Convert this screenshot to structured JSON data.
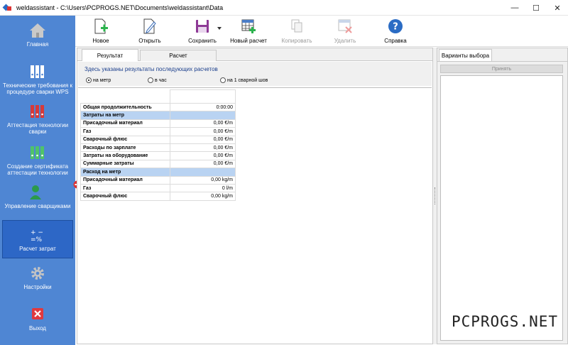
{
  "window": {
    "title": "weldassistant - C:\\Users\\PCPROGS.NET\\Documents\\weldassistant\\Data",
    "controls": {
      "minimize": "—",
      "maximize": "☐",
      "close": "✕"
    }
  },
  "sidebar": {
    "items": [
      {
        "label": "Главная",
        "icon": "home-icon"
      },
      {
        "label": "Технические требования к процедуре сварки WPS",
        "icon": "binders-icon"
      },
      {
        "label": "Аттестация технологии сварки",
        "icon": "binders-icon"
      },
      {
        "label": "Создание сертификата аттестации технологии сварки",
        "icon": "binders-icon"
      },
      {
        "label": "Управление сварщиками",
        "icon": "user-icon"
      },
      {
        "label": "Расчет затрат",
        "icon": "calculator-icon"
      },
      {
        "label": "Настройки",
        "icon": "gear-icon"
      },
      {
        "label": "Выход",
        "icon": "exit-icon"
      }
    ]
  },
  "toolbar": {
    "new": "Новое",
    "open": "Открыть",
    "save": "Сохранить",
    "new_calc": "Новый расчет",
    "copy": "Копировать",
    "delete": "Удалить",
    "help": "Справка"
  },
  "tabs": {
    "results": "Результат",
    "calculation": "Расчет"
  },
  "results": {
    "description": "Здесь указаны результаты последующих расчетов",
    "radios": [
      "на метр",
      "в час",
      "на 1 сварной шов"
    ],
    "selected": "на метр",
    "rows": [
      {
        "label": "Общая продолжительность",
        "value": "0:00:00"
      },
      {
        "label": "Затраты на метр",
        "value": ""
      },
      {
        "label": "Присадочный материал",
        "value": "0,00 €/m"
      },
      {
        "label": "Газ",
        "value": "0,00 €/m"
      },
      {
        "label": "Сварочный флюс",
        "value": "0,00 €/m"
      },
      {
        "label": "Расходы по зарплате",
        "value": "0,00 €/m"
      },
      {
        "label": "Затраты на оборудование",
        "value": "0,00 €/m"
      },
      {
        "label": "Суммарные затраты",
        "value": "0,00 €/m"
      },
      {
        "label": "Расход на метр",
        "value": ""
      },
      {
        "label": "Присадочный материал",
        "value": "0,00 kg/m"
      },
      {
        "label": "Газ",
        "value": "0 l/m"
      },
      {
        "label": "Сварочный флюс",
        "value": "0,00 kg/m"
      }
    ]
  },
  "right_panel": {
    "tab": "Варианты выбора",
    "accept": "Принять"
  },
  "watermark": "PCPROGS.NET",
  "colors": {
    "sidebar": "#4f86d3",
    "sidebar_active": "#2d67c6",
    "section_row": "#b9d3f2"
  }
}
